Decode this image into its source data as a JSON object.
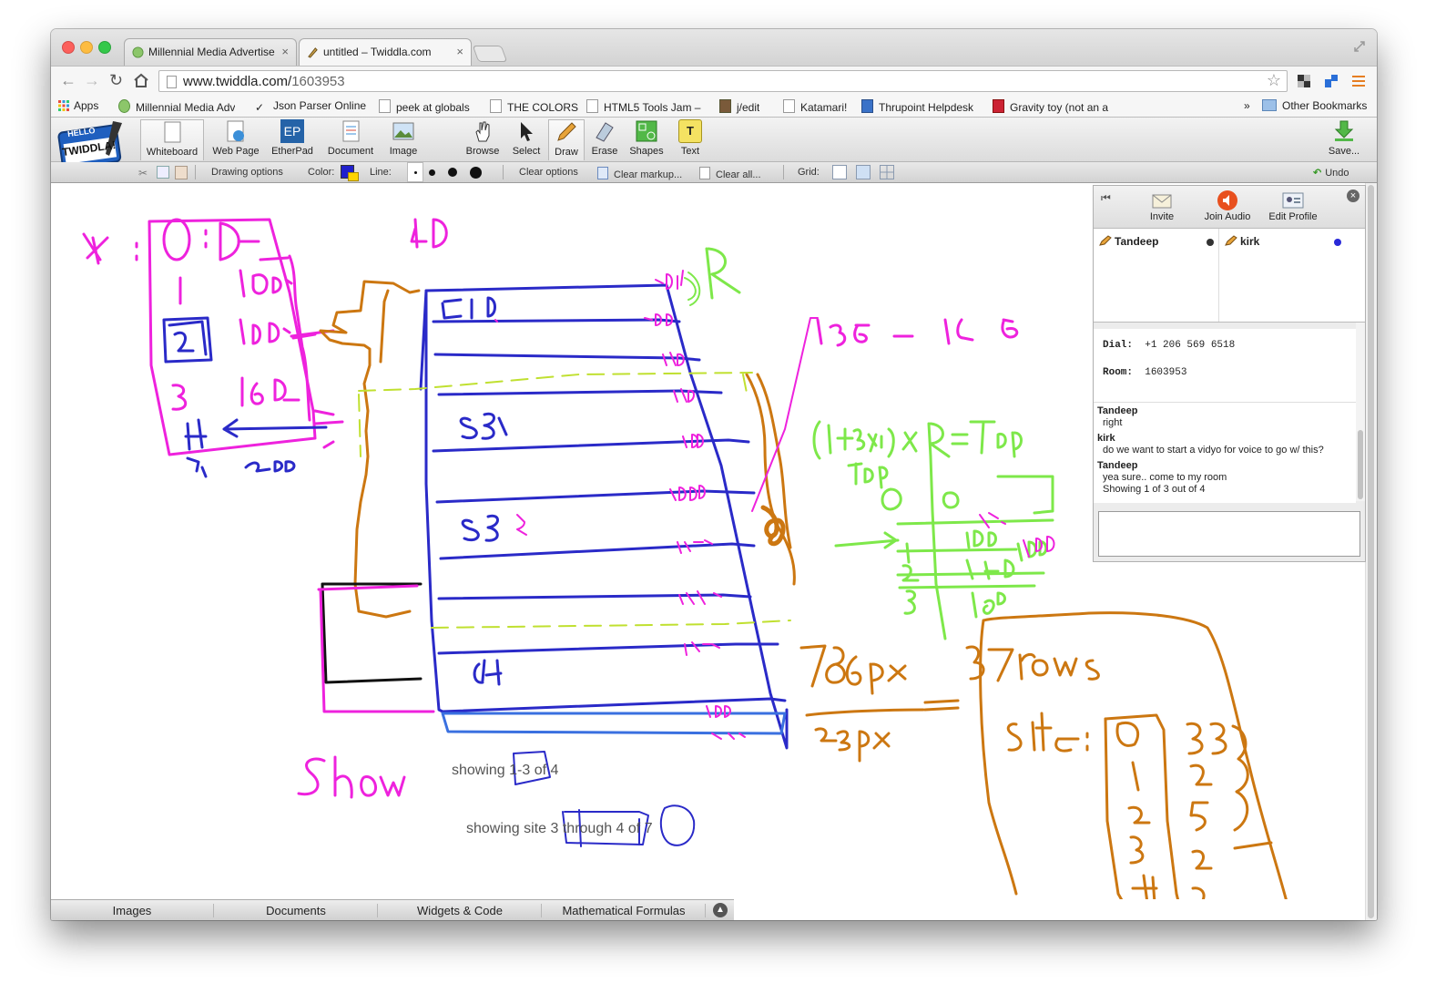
{
  "browser": {
    "tabs": [
      {
        "title": "Millennial Media Advertise",
        "close": "×",
        "active": false
      },
      {
        "title": "untitled – Twiddla.com",
        "close": "×",
        "active": true
      }
    ],
    "url_host": "www.twiddla.com/",
    "url_path": "1603953",
    "bookmarks": [
      {
        "label": "Apps"
      },
      {
        "label": "Millennial Media Adv"
      },
      {
        "label": "Json Parser Online"
      },
      {
        "label": "peek at globals"
      },
      {
        "label": "THE COLORS"
      },
      {
        "label": "HTML5 Tools Jam – I"
      },
      {
        "label": "j/edit"
      },
      {
        "label": "Katamari!"
      },
      {
        "label": "Thrupoint Helpdesk"
      },
      {
        "label": "Gravity toy (not an a"
      }
    ],
    "bookmarks_overflow": "»",
    "other_bookmarks": "Other Bookmarks"
  },
  "app": {
    "logo_text": "HELLO",
    "logo_name": "TWIDDLA!",
    "tools": [
      {
        "label": "Whiteboard",
        "icon": "whiteboard-icon"
      },
      {
        "label": "Web Page",
        "icon": "web-page-icon"
      },
      {
        "label": "EtherPad",
        "icon": "etherpad-icon",
        "glyph": "EP"
      },
      {
        "label": "Document",
        "icon": "document-icon"
      },
      {
        "label": "Image",
        "icon": "image-icon"
      },
      {
        "label": "Browse",
        "icon": "hand-icon"
      },
      {
        "label": "Select",
        "icon": "cursor-icon"
      },
      {
        "label": "Draw",
        "icon": "pencil-icon"
      },
      {
        "label": "Erase",
        "icon": "eraser-icon"
      },
      {
        "label": "Shapes",
        "icon": "shapes-icon"
      },
      {
        "label": "Text",
        "icon": "text-icon",
        "glyph": "T"
      }
    ],
    "save_label": "Save...",
    "options": {
      "drawing_options": "Drawing options",
      "color_label": "Color:",
      "line_label": "Line:",
      "clear_options": "Clear options",
      "clear_markup": "Clear markup...",
      "clear_all": "Clear all...",
      "grid_label": "Grid:",
      "undo_label": "Undo"
    },
    "colors": {
      "draw_primary": "#2020cc",
      "draw_secondary": "#ffd400"
    }
  },
  "board": {
    "text_1_pre": "showing ",
    "text_1_range": "1-3",
    "text_1_post": " of 4",
    "text_2_pre": "showing site ",
    "text_2_range": "3 through 4",
    "text_2_post": " of 7"
  },
  "bottom_tabs": [
    "Images",
    "Documents",
    "Widgets & Code",
    "Mathematical Formulas"
  ],
  "panel": {
    "buttons": [
      "Invite",
      "Join Audio",
      "Edit Profile"
    ],
    "users": [
      {
        "name": "Tandeep",
        "status_color": "#333333"
      },
      {
        "name": "kirk",
        "status_color": "#2a2ad8"
      }
    ],
    "dial_label": "Dial:",
    "dial_value": "+1 206 569 6518",
    "room_label": "Room:",
    "room_value": "1603953",
    "messages": [
      {
        "name": "Tandeep",
        "text": "right"
      },
      {
        "name": "kirk",
        "text": "do we want to start a vidyo for voice to go w/ this?"
      },
      {
        "name": "Tandeep",
        "text": "yea sure.. come to my room"
      },
      {
        "name": "",
        "text": "Showing 1 of 3 out of 4"
      }
    ]
  }
}
